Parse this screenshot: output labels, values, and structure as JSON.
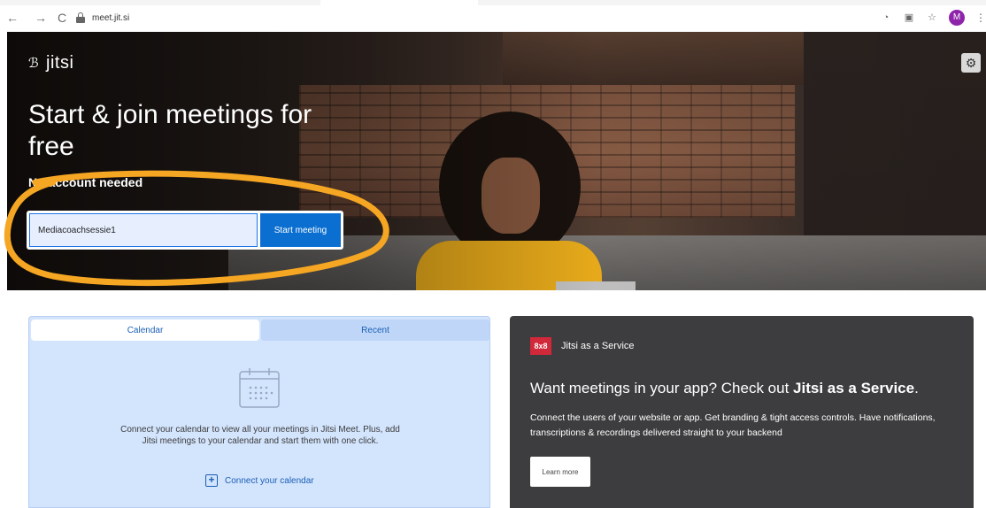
{
  "browser": {
    "url": "meet.jit.si",
    "back_icon": "←",
    "forward_icon": "→",
    "reload_icon": "C",
    "profile_initial": "M"
  },
  "header": {
    "logo_text": "jitsi",
    "logo_mark": "ℬ",
    "settings_icon": "⚙"
  },
  "hero": {
    "title": "Start & join meetings for free",
    "subtitle": "No account needed",
    "room_input_value": "Mediacoachsessie1",
    "start_button_label": "Start meeting"
  },
  "calendar_panel": {
    "tabs": [
      {
        "label": "Calendar",
        "active": true
      },
      {
        "label": "Recent",
        "active": false
      }
    ],
    "description": "Connect your calendar to view all your meetings in Jitsi Meet. Plus, add Jitsi meetings to your calendar and start them with one click.",
    "connect_label": "Connect your calendar",
    "connect_icon": "+"
  },
  "jaas_panel": {
    "logo_text": "8x8",
    "label": "Jitsi as a Service",
    "headline_prefix": "Want meetings in your app? Check out ",
    "headline_bold": "Jitsi as a Service",
    "headline_suffix": ".",
    "description": "Connect the users of your website or app. Get branding & tight access controls. Have notifications, transcriptions & recordings delivered straight to your backend",
    "learn_more_label": "Learn more"
  },
  "colors": {
    "accent_blue": "#0b6fd1",
    "highlight_orange": "#f5a623",
    "jaas_background": "#3d3d3f",
    "calendar_background": "#d3e4fd"
  }
}
